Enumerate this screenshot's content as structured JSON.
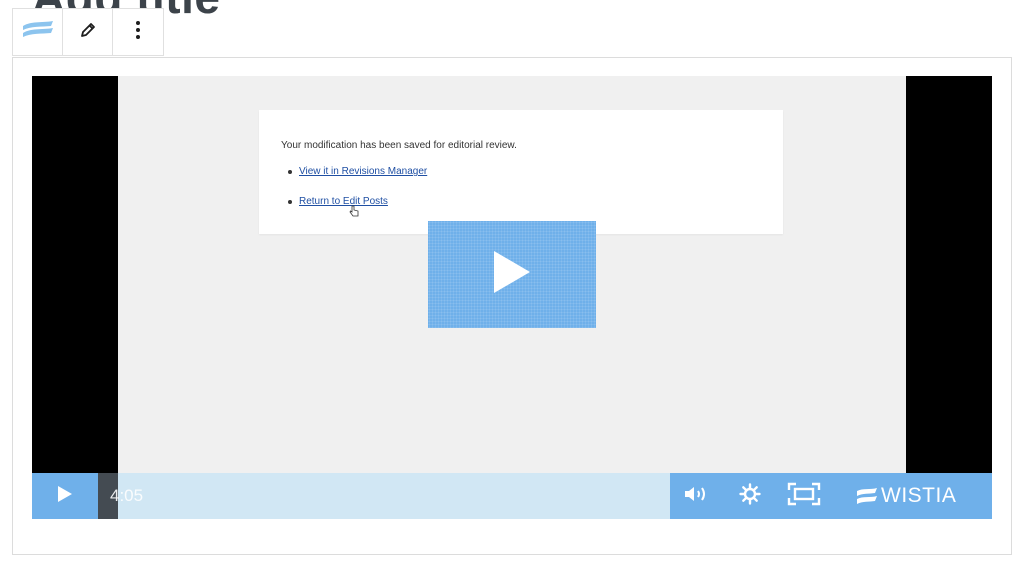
{
  "page": {
    "title": "Add title"
  },
  "toolbar": {
    "items": [
      {
        "icon": "wistia-block-icon"
      },
      {
        "icon": "pencil-icon"
      },
      {
        "icon": "more-vertical-icon"
      }
    ]
  },
  "video": {
    "notice": {
      "message": "Your modification has been saved for editorial review.",
      "links": [
        "View it in Revisions Manager",
        "Return to Edit Posts"
      ]
    },
    "controls": {
      "time": "4:05",
      "brand": "WISTIA"
    }
  },
  "colors": {
    "accent": "#6fb0ea",
    "progress_track": "#d1e7f4",
    "link": "#1f4fa3"
  }
}
